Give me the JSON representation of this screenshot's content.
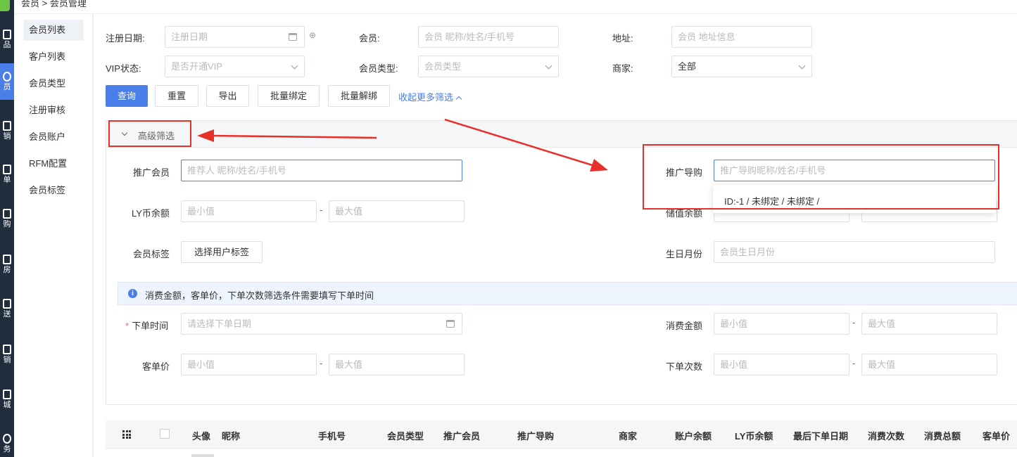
{
  "topbar": {
    "crumb": "会员  >  会员管理"
  },
  "rail": {
    "items": [
      {
        "label": "品"
      },
      {
        "label": "员"
      },
      {
        "label": "销"
      },
      {
        "label": "单"
      },
      {
        "label": "购"
      },
      {
        "label": "房"
      },
      {
        "label": "送"
      },
      {
        "label": "销"
      },
      {
        "label": "城"
      },
      {
        "label": "务"
      }
    ]
  },
  "submenu": {
    "items": [
      "会员列表",
      "客户列表",
      "会员类型",
      "注册审核",
      "会员账户",
      "RFM配置",
      "会员标签"
    ]
  },
  "filters": {
    "reg_date_label": "注册日期:",
    "reg_date_placeholder": "注册日期",
    "member_label": "会员:",
    "member_placeholder": "会员 昵称/姓名/手机号",
    "address_label": "地址:",
    "address_placeholder": "会员 地址信息",
    "vip_label": "VIP状态:",
    "vip_placeholder": "是否开通VIP",
    "member_type_label": "会员类型:",
    "member_type_placeholder": "会员类型",
    "merchant_label": "商家:",
    "merchant_value": "全部"
  },
  "buttons": {
    "query": "查询",
    "reset": "重置",
    "export": "导出",
    "batch_bind": "批量绑定",
    "batch_unbind": "批量解绑",
    "collapse_more": "收起更多筛选"
  },
  "advanced": {
    "title": "高级筛选",
    "promoter_label": "推广会员",
    "promoter_placeholder": "推荐人 昵称/姓名/手机号",
    "guide_label": "推广导购",
    "guide_placeholder": "推广导购昵称/姓名/手机号",
    "guide_option": "ID:-1 / 未绑定 / 未绑定 /",
    "ly_label": "LY币余额",
    "min_placeholder": "最小值",
    "max_placeholder": "最大值",
    "stored_label": "储值余额",
    "tag_label": "会员标签",
    "tag_button": "选择用户标签",
    "birthday_label": "生日月份",
    "birthday_placeholder": "会员生日月份",
    "notice": "消费金额，客单价，下单次数筛选条件需要填写下单时间",
    "order_time_label": "下单时间",
    "order_time_required": "*",
    "order_time_placeholder": "请选择下单日期",
    "spend_label": "消费金额",
    "avg_label": "客单价",
    "count_label": "下单次数",
    "range_sep": "-"
  },
  "table": {
    "headers": [
      "头像",
      "昵称",
      "手机号",
      "会员类型",
      "推广会员",
      "推广导购",
      "商家",
      "账户余额",
      "LY币余额",
      "最后下单日期",
      "消费次数",
      "消费总额",
      "客单价"
    ]
  },
  "colors": {
    "primary": "#4a7ee8",
    "annotation": "#e8302a",
    "rail": "#1f2d3d"
  }
}
